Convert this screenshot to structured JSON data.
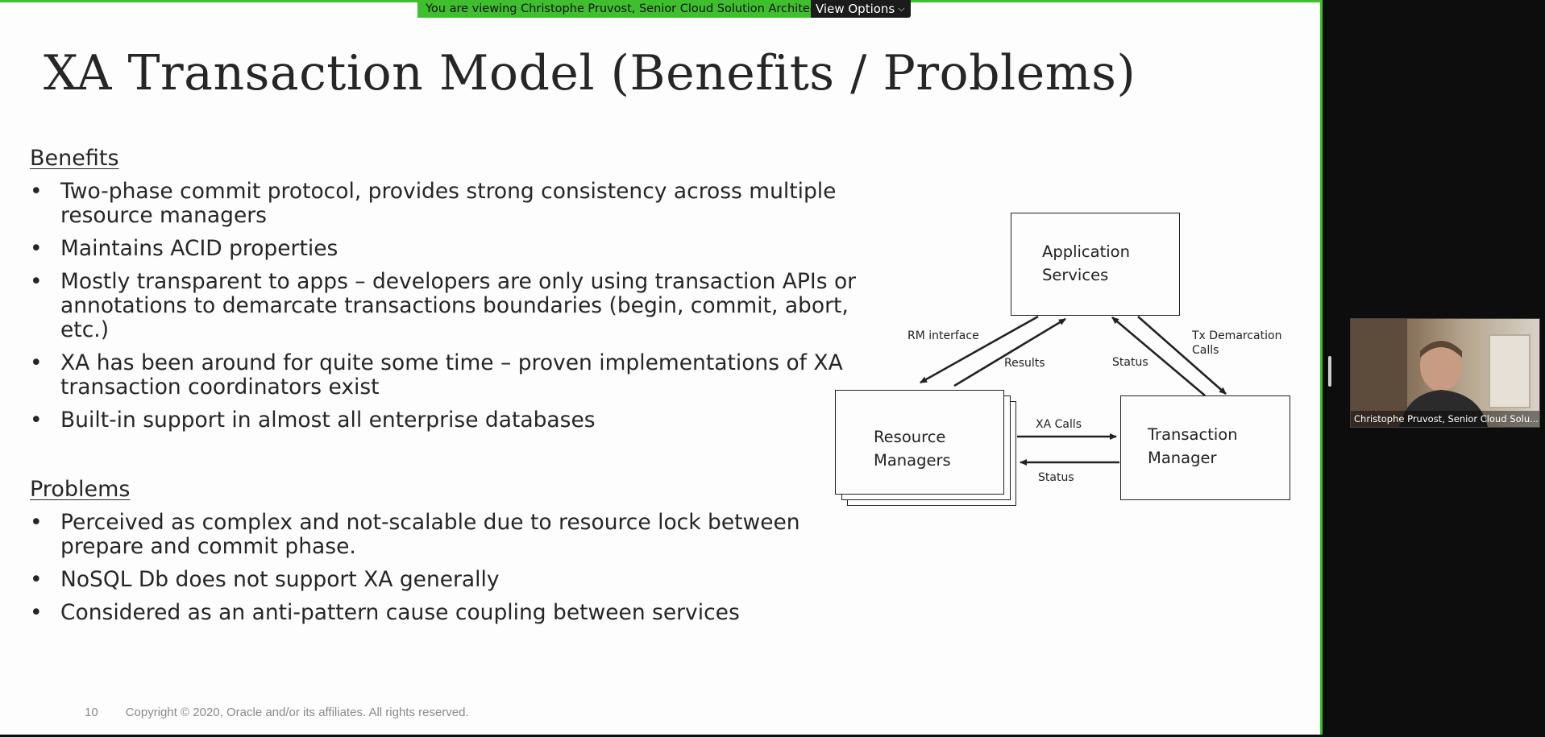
{
  "banner": {
    "viewing_text": "You are viewing Christophe Pruvost, Senior Cloud Solution Architect",
    "view_options_label": "View Options",
    "view_options_icon": "chevron-down-icon"
  },
  "slide": {
    "title": "XA Transaction Model (Benefits / Problems)",
    "benefits_heading": "Benefits",
    "benefits": [
      "Two-phase commit protocol, provides strong consistency across multiple resource managers",
      "Maintains ACID properties",
      "Mostly transparent to apps – developers are only using transaction APIs or annotations to demarcate transactions boundaries (begin, commit, abort, etc.)",
      "XA has been around for quite some time – proven implementations of XA transaction coordinators exist",
      "Built-in support in almost all enterprise databases"
    ],
    "problems_heading": "Problems",
    "problems": [
      "Perceived as complex and not-scalable due to resource lock between prepare and commit phase.",
      "NoSQL Db does not support XA generally",
      "Considered as an anti-pattern cause coupling between services"
    ],
    "bullet_char": "•",
    "page_number": "10",
    "copyright": "Copyright © 2020, Oracle and/or its affiliates. All rights reserved."
  },
  "diagram": {
    "app_services": "Application\nServices",
    "resource_managers": "Resource\nManagers",
    "transaction_manager": "Transaction\nManager",
    "rm_interface": "RM interface",
    "results": "Results",
    "status_top": "Status",
    "tx_demarcation": "Tx Demarcation\nCalls",
    "xa_calls": "XA Calls",
    "status_bottom": "Status"
  },
  "video": {
    "participant_caption": "Christophe Pruvost, Senior Cloud Solu..."
  },
  "colors": {
    "share_green": "#3fbf2d",
    "slide_bg": "#fdfdfd",
    "app_bg": "#0d0d0d"
  }
}
